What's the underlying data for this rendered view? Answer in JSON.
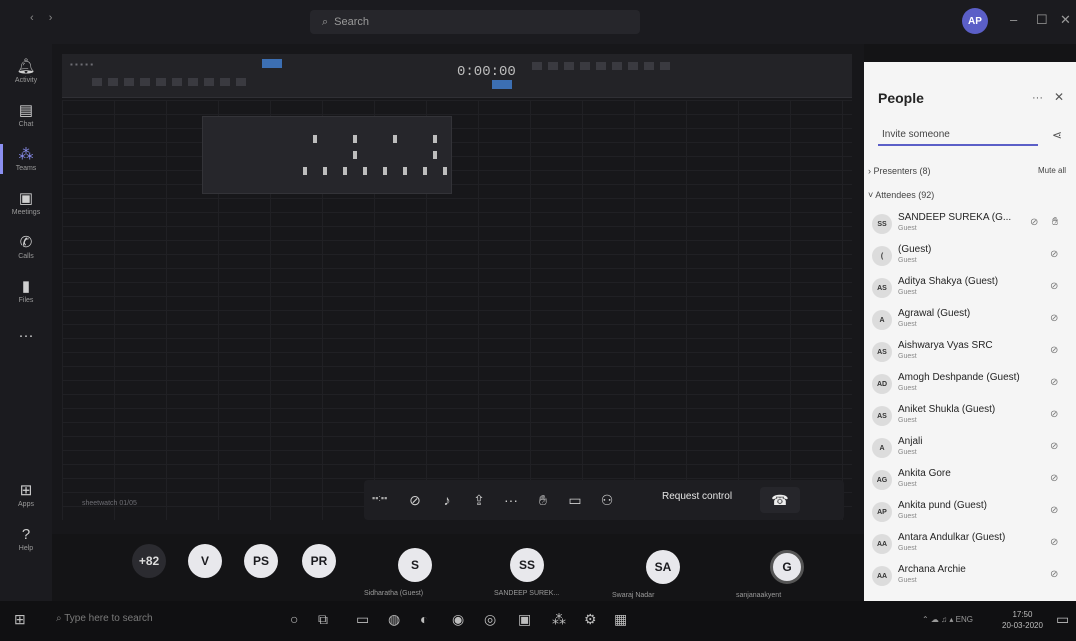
{
  "titlebar": {
    "search_placeholder": "Search",
    "user_initials": "AP"
  },
  "rail": {
    "items": [
      {
        "label": "Activity",
        "icon": "bell-icon"
      },
      {
        "label": "Chat",
        "icon": "chat-icon"
      },
      {
        "label": "Teams",
        "icon": "teams-icon"
      },
      {
        "label": "Meetings",
        "icon": "calendar-icon"
      },
      {
        "label": "Calls",
        "icon": "phone-icon"
      },
      {
        "label": "Files",
        "icon": "file-icon"
      }
    ],
    "bottom": [
      {
        "label": "Apps",
        "icon": "apps-icon"
      },
      {
        "label": "Help",
        "icon": "help-icon"
      }
    ]
  },
  "shared_screen": {
    "timer": "0:00:00",
    "sheet_label": "sheetwatch 01/05"
  },
  "controls": {
    "request_control_label": "Request control"
  },
  "participants_strip": {
    "overflow_count": "+82",
    "avatars": [
      {
        "initials": "V"
      },
      {
        "initials": "PS"
      },
      {
        "initials": "PR"
      },
      {
        "initials": "S",
        "name": "Sidharatha (Guest)"
      },
      {
        "initials": "SS",
        "name": "SANDEEP SUREK..."
      },
      {
        "initials": "SA",
        "name": "Swaraj Nadar"
      },
      {
        "initials": "G",
        "name": "sanjanaakyent"
      }
    ]
  },
  "people_panel": {
    "title": "People",
    "invite_placeholder": "Invite someone",
    "presenters_label": "Presenters (8)",
    "mute_all_label": "Mute all",
    "attendees_label": "Attendees (92)",
    "attendees": [
      {
        "initials": "SS",
        "name": "SANDEEP SUREKA (G...",
        "role": "Guest",
        "hand_raised": true
      },
      {
        "initials": "(",
        "name": "(Guest)",
        "role": "Guest"
      },
      {
        "initials": "AS",
        "name": "Aditya Shakya (Guest)",
        "role": "Guest"
      },
      {
        "initials": "A",
        "name": "Agrawal (Guest)",
        "role": "Guest"
      },
      {
        "initials": "AS",
        "name": "Aishwarya Vyas SRC",
        "role": "Guest"
      },
      {
        "initials": "AD",
        "name": "Amogh Deshpande (Guest)",
        "role": "Guest"
      },
      {
        "initials": "AS",
        "name": "Aniket Shukla (Guest)",
        "role": "Guest"
      },
      {
        "initials": "A",
        "name": "Anjali",
        "role": "Guest"
      },
      {
        "initials": "AG",
        "name": "Ankita Gore",
        "role": "Guest"
      },
      {
        "initials": "AP",
        "name": "Ankita pund (Guest)",
        "role": "Guest"
      },
      {
        "initials": "AA",
        "name": "Antara Andulkar (Guest)",
        "role": "Guest"
      },
      {
        "initials": "AA",
        "name": "Archana Archie",
        "role": "Guest"
      }
    ]
  },
  "taskbar": {
    "search_placeholder": "Type here to search",
    "language": "ENG",
    "time": "17:50",
    "date": "20-03-2020"
  }
}
